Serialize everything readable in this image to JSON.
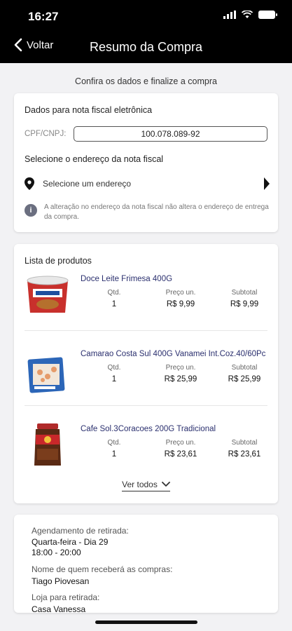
{
  "status_bar": {
    "time": "16:27"
  },
  "nav": {
    "back_label": "Voltar",
    "title": "Resumo da Compra"
  },
  "subtitle": "Confira os dados e finalize a compra",
  "fiscal": {
    "section_title": "Dados para nota fiscal eletrônica",
    "cpf_label": "CPF/CNPJ:",
    "cpf_value": "100.078.089-92",
    "address_title": "Selecione o endereço da nota fiscal",
    "address_placeholder": "Selecione um endereço",
    "info_text": "A alteração no endereço da nota fiscal não altera o endereço de entrega da compra."
  },
  "products": {
    "section_title": "Lista de produtos",
    "col_qtd": "Qtd.",
    "col_price": "Preço un.",
    "col_subtotal": "Subtotal",
    "items": [
      {
        "name": "Doce Leite Frimesa 400G",
        "qty": "1",
        "price": "R$ 9,99",
        "subtotal": "R$ 9,99"
      },
      {
        "name": "Camarao Costa Sul 400G Vanamei Int.Coz.40/60Pc",
        "qty": "1",
        "price": "R$ 25,99",
        "subtotal": "R$ 25,99"
      },
      {
        "name": "Cafe Sol.3Coracoes 200G Tradicional",
        "qty": "1",
        "price": "R$ 23,61",
        "subtotal": "R$ 23,61"
      }
    ],
    "see_all": "Ver todos"
  },
  "pickup": {
    "schedule_label": "Agendamento de retirada:",
    "schedule_day": "Quarta-feira - Dia 29",
    "schedule_time": "18:00 - 20:00",
    "receiver_label": "Nome de quem receberá as compras:",
    "receiver_name": "Tiago Piovesan",
    "store_label": "Loja para retirada:",
    "store_name": "Casa Vanessa"
  }
}
